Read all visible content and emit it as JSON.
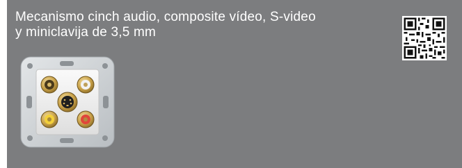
{
  "card": {
    "title_line1": "Mecanismo cinch audio, composite vídeo, S-video",
    "title_line2": "y miniclavija de 3,5 mm"
  },
  "qr_code": {
    "icon": "qr-code-icon"
  },
  "product_image": {
    "icon": "av-socket-plate-image",
    "connector_colors": {
      "left": "#c9a24a",
      "right": "#e8e8e8",
      "center": "#c9a24a",
      "bottom_left": "#f3d03a",
      "bottom_right": "#e0473a",
      "plate": "#d8dcdf",
      "insert": "#f2f2f2"
    }
  },
  "colors": {
    "panel": "#7c7d7f",
    "title_text": "#ffffff"
  }
}
